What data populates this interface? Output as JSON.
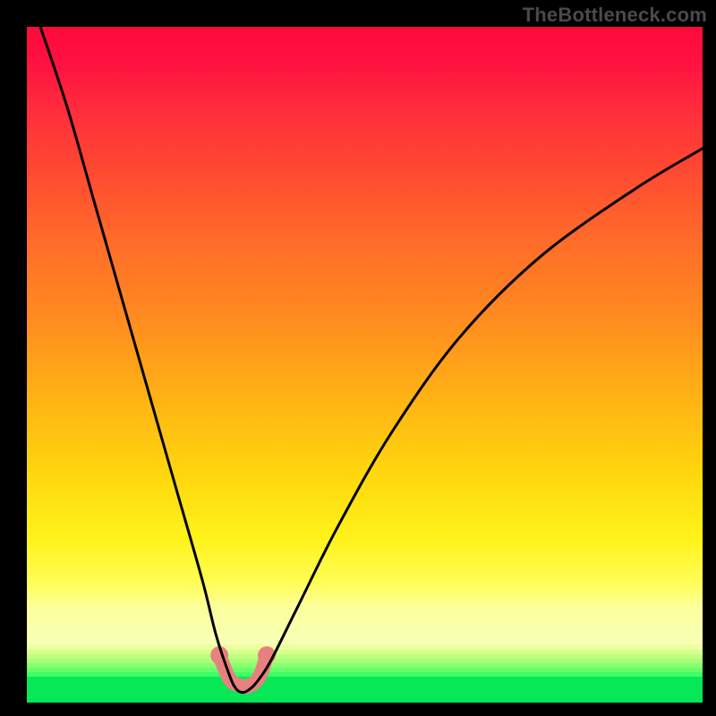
{
  "watermark": "TheBottleneck.com",
  "chart_data": {
    "type": "line",
    "title": "",
    "xlabel": "",
    "ylabel": "",
    "xlim": [
      0,
      100
    ],
    "ylim": [
      0,
      100
    ],
    "grid": false,
    "legend": false,
    "series": [
      {
        "name": "bottleneck-curve",
        "x": [
          2,
          6,
          10,
          14,
          18,
          22,
          26,
          28,
          30,
          31,
          32,
          33,
          34,
          36,
          40,
          46,
          54,
          64,
          76,
          90,
          100
        ],
        "y": [
          100,
          88,
          74,
          60,
          46,
          32,
          18,
          10,
          4,
          2,
          1.5,
          2,
          3,
          6,
          14,
          26,
          40,
          54,
          66,
          76,
          82
        ]
      }
    ],
    "highlight": {
      "name": "optimal-range",
      "x": [
        28.5,
        30.0,
        31.5,
        33.0,
        34.5,
        35.5
      ],
      "y": [
        7.0,
        3.5,
        2.5,
        2.5,
        4.0,
        7.0
      ],
      "endpoints": [
        {
          "x": 28.5,
          "y": 7.0
        },
        {
          "x": 35.5,
          "y": 7.0
        }
      ]
    },
    "background": {
      "type": "vertical-gradient",
      "stops": [
        {
          "pos": 0.0,
          "color": "#ff0a3a"
        },
        {
          "pos": 0.45,
          "color": "#ff8a20"
        },
        {
          "pos": 0.78,
          "color": "#fff219"
        },
        {
          "pos": 0.88,
          "color": "#f8ffb8"
        },
        {
          "pos": 0.93,
          "color": "#88ff70"
        },
        {
          "pos": 1.0,
          "color": "#06e856"
        }
      ]
    }
  }
}
